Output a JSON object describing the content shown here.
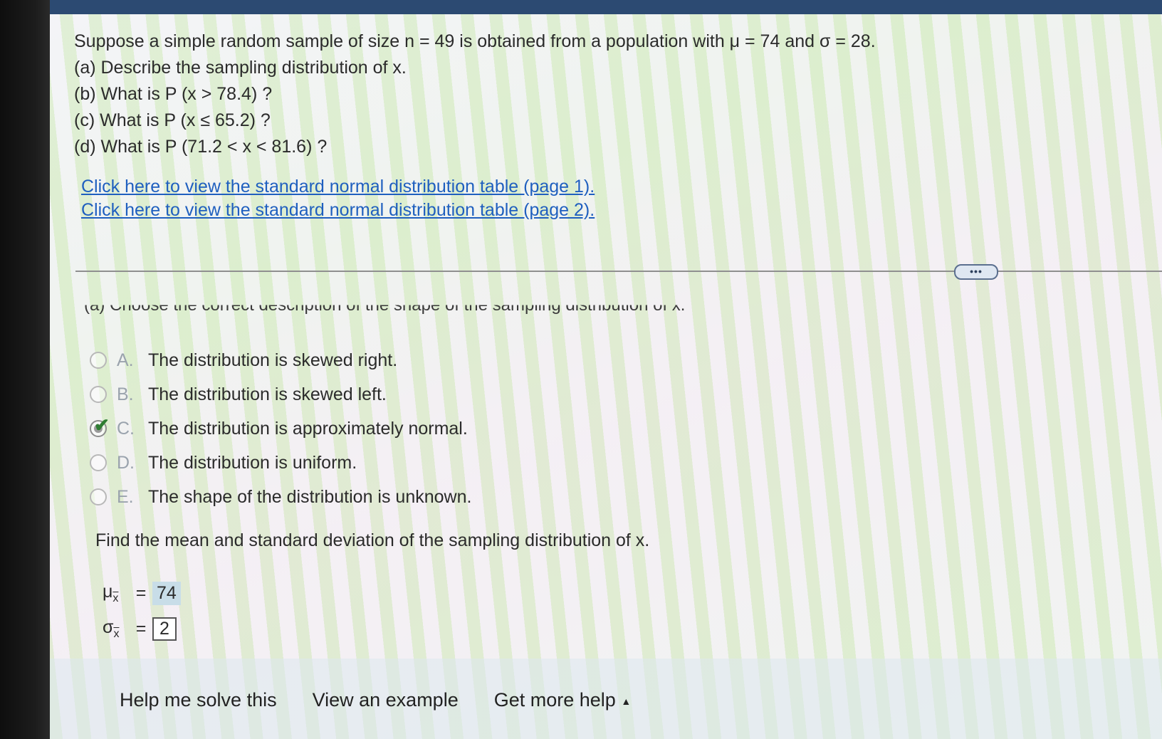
{
  "problem": {
    "intro": "Suppose a simple random sample of size n = 49 is obtained from a population with μ = 74 and σ = 28.",
    "part_a": "(a) Describe the sampling distribution of x.",
    "part_b": "(b) What is P (x > 78.4) ?",
    "part_c": "(c) What is P (x ≤ 65.2) ?",
    "part_d": "(d) What is P (71.2 < x < 81.6) ?"
  },
  "links": {
    "table_page1": "Click here to view the standard normal distribution table (page 1).",
    "table_page2": "Click here to view the standard normal distribution table (page 2)."
  },
  "more_button": "•••",
  "part_a_prompt": "(a) Choose the correct description of the shape of the sampling distribution of x.",
  "options": [
    {
      "letter": "A.",
      "text": "The distribution is skewed right."
    },
    {
      "letter": "B.",
      "text": "The distribution is skewed left."
    },
    {
      "letter": "C.",
      "text": "The distribution is approximately normal."
    },
    {
      "letter": "D.",
      "text": "The distribution is uniform."
    },
    {
      "letter": "E.",
      "text": "The shape of the distribution is unknown."
    }
  ],
  "selected_option": "C",
  "find_text": "Find the mean and standard deviation of the sampling distribution of x.",
  "answers": {
    "mean_symbol": "μ",
    "sd_symbol": "σ",
    "subscript": "x",
    "equals": "=",
    "mean_value": "74",
    "sd_value": "2"
  },
  "help": {
    "solve": "Help me solve this",
    "example": "View an example",
    "more_help": "Get more help"
  }
}
